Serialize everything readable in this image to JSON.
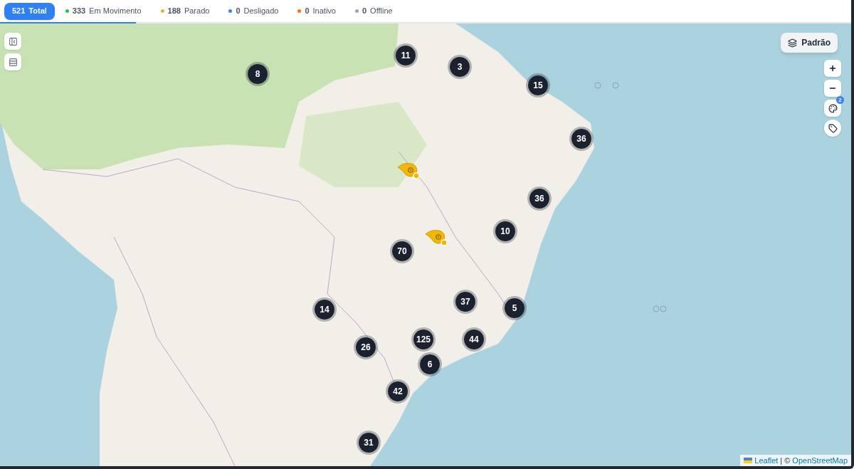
{
  "status_tabs": [
    {
      "count": "521",
      "label": "Total",
      "selected": true
    },
    {
      "count": "333",
      "label": "Em Movimento",
      "selected": false,
      "color": "#22c55e"
    },
    {
      "count": "188",
      "label": "Parado",
      "selected": false,
      "color": "#e5b53b"
    },
    {
      "count": "0",
      "label": "Desligado",
      "selected": false,
      "color": "#3b82f6"
    },
    {
      "count": "0",
      "label": "Inativo",
      "selected": false,
      "color": "#f97316"
    },
    {
      "count": "0",
      "label": "Offline",
      "selected": false,
      "color": "#9ca3af"
    }
  ],
  "loading_bar": {
    "level": 0.16
  },
  "layer_button": {
    "label": "Padrão"
  },
  "palette_badge": "2",
  "clusters": [
    {
      "count": "11"
    },
    {
      "count": "3"
    },
    {
      "count": "8"
    },
    {
      "count": "15"
    },
    {
      "count": "36"
    },
    {
      "count": "36"
    },
    {
      "count": "10"
    },
    {
      "count": "70"
    },
    {
      "count": "37"
    },
    {
      "count": "5"
    },
    {
      "count": "14"
    },
    {
      "count": "125"
    },
    {
      "count": "44"
    },
    {
      "count": "26"
    },
    {
      "count": "6"
    },
    {
      "count": "42"
    },
    {
      "count": "31"
    }
  ],
  "vehicle_markers": [
    {
      "color": "#f2b705"
    },
    {
      "color": "#f2b705"
    }
  ],
  "attribution": {
    "leaflet": "Leaflet",
    "separator": "| ©",
    "source": "OpenStreetMap"
  }
}
